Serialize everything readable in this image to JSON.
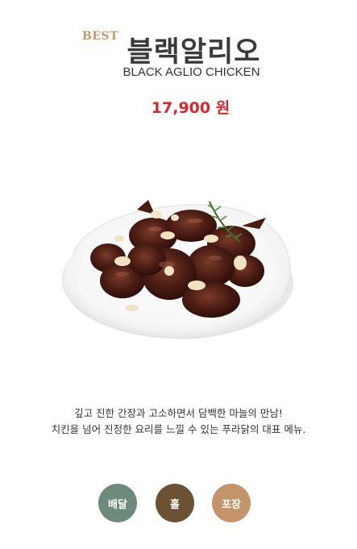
{
  "product": {
    "badge": "BEST",
    "name_ko": "블랙알리오",
    "name_en": "BLACK AGLIO CHICKEN",
    "price": "17,900 원",
    "image_icon": "chicken-dish-photo",
    "description_lines": [
      "깊고 진한 간장과 고소하면서 담백한 마늘의 만남!",
      "치킨을 넘어 진정한 요리를 느낄 수 있는 푸라닭의 대표 메뉴."
    ]
  },
  "service_buttons": [
    {
      "label": "배달",
      "color": "#6e8a7c"
    },
    {
      "label": "홀",
      "color": "#6d5134"
    },
    {
      "label": "포장",
      "color": "#c39369"
    }
  ],
  "colors": {
    "badge": "#c49a6c",
    "price": "#d7282d",
    "title": "#3a3a3a"
  }
}
